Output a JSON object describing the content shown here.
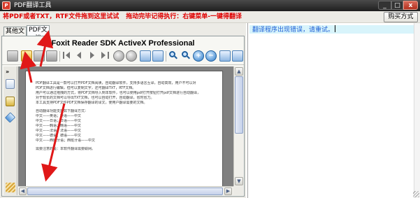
{
  "window": {
    "title": "PDF翻译工具",
    "app_icon": "pdf-app-icon",
    "controls": {
      "minimize": "_",
      "maximize": "□",
      "close": "x"
    }
  },
  "notice": {
    "part1": "将PDF或者TXT，RTF文件拖到这里试试",
    "part2": "拖动完毕记得执行：右键菜单-一键得翻译",
    "color": "#e00000"
  },
  "convert_button": {
    "label": "购买方式"
  },
  "tabs": [
    {
      "label": "其他文档",
      "active": false
    },
    {
      "label": "PDF文档",
      "active": true
    }
  ],
  "viewer": {
    "title": "Foxit Reader SDK ActiveX Professional",
    "toolbar_icons": [
      "open-folder-icon",
      "open-file-icon",
      "save-icon",
      "print-icon",
      "first-page-icon",
      "previous-page-icon",
      "next-page-icon",
      "last-page-icon",
      "stop-icon",
      "refresh-icon",
      "copy-icon",
      "select-icon",
      "zoom-in-icon",
      "zoom-out-icon",
      "rotate-left-icon",
      "rotate-right-icon",
      "actual-size-icon",
      "fit-page-icon"
    ],
    "nav_icons": [
      "pages-icon",
      "bookmark-icon",
      "layers-icon",
      "signature-icon"
    ],
    "nav_toggle": "»"
  },
  "document_lines": [
    "PDF翻译工具是一款可以打开PDF文档阅读，自动翻译软件，支持多语言互译，自动高效，用户不可以对",
    "PDF文档进行编辑，但可以复制文字，还可翻译TXT，RTF文档。",
    "用户可以通过拖拽的方式，将PDF文档导入到本软件，也可以使用pdf打开按钮打开pdf文档进行自动翻译，",
    "对于较长的文档可以导出TXT文档，也可以自动打开，自动翻译，省时省力。",
    "本工具支持PDF文件PDF文档保存翻译的译文，使用户翻译需要的文档。",
    "",
    "自动翻译功能支持如下翻译方式：",
    "中文——英语；英语——中文",
    "中文——日语；日语——中文",
    "中文——韩语；韩语——中文",
    "中文——法语；法语——中文",
    "中文——德语；德语——中文",
    "中文——西班牙语；西班牙语——中文",
    "",
    "需要注意的是：本软件翻译需要联网。"
  ],
  "result": {
    "text": "翻译程序出现错误，请重试。",
    "color": "#1e5fd6",
    "background": "#d8f4fb"
  },
  "colors": {
    "titlebar": "#2a2a2a",
    "panel": "#ecebe6",
    "annotation_arrow": "#e01818"
  }
}
